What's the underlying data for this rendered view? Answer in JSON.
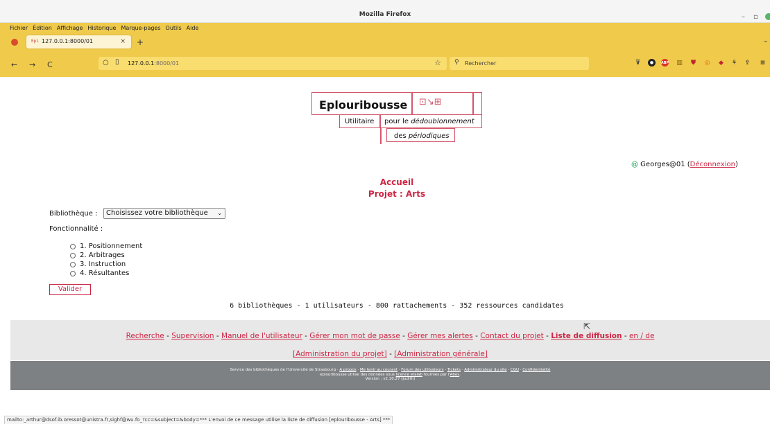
{
  "window": {
    "title": "Mozilla Firefox",
    "minimize": "–",
    "maximize": "▫"
  },
  "menu": [
    "Fichier",
    "Édition",
    "Affichage",
    "Historique",
    "Marque-pages",
    "Outils",
    "Aide"
  ],
  "tab": {
    "favicon_text": "Epi",
    "label": "127.0.0.1:8000/01",
    "close": "×",
    "new_tab": "+"
  },
  "nav": {
    "back": "←",
    "forward": "→",
    "reload": "C",
    "url_host": "127.0.0.1",
    "url_rest": ":8000/01",
    "star": "☆",
    "search_placeholder": "Rechercher",
    "menu_icon": "≡",
    "overflow_icon": "⌄"
  },
  "logo": {
    "name": "Eplouribousse",
    "icons": "⊡↘⊞",
    "utilitaire": "Utilitaire",
    "pour_prefix": "pour le ",
    "pour_italic": "dédoublonnement",
    "des_prefix": "des ",
    "des_italic": "périodiques"
  },
  "user": {
    "at": "@",
    "name": " Georges@01 (",
    "logout": "Déconnexion",
    "close_paren": ")"
  },
  "page": {
    "heading": "Accueil",
    "project": "Projet : Arts",
    "library_label": "Bibliothèque :",
    "library_select": "Choisissez votre bibliothèque",
    "select_arrow": "⌄",
    "function_label": "Fonctionnalité :",
    "options": [
      "1. Positionnement",
      "2. Arbitrages",
      "3. Instruction",
      "4. Résultantes"
    ],
    "submit": "Valider",
    "stats": "6 bibliothèques - 1 utilisateurs - 800 rattachements - 352 ressources candidates"
  },
  "footer": {
    "links": [
      "Recherche",
      "Supervision",
      "Manuel de l'utilisateur",
      "Gérer mon mot de passe",
      "Gérer mes alertes",
      "Contact du projet",
      "Liste de diffusion",
      "en / de"
    ],
    "separator": " - ",
    "admin_project": "[Administration du projet]",
    "admin_general": "[Administration générale]",
    "bottom_line1_prefix": "Service des bibliothèques de l'Université de Strasbourg · ",
    "bottom_links": [
      "A propos",
      "Me tenir au courant",
      "Forum des utilisateurs",
      "Tickets",
      "Administrateur du site",
      "CGU",
      "Confidentialité"
    ],
    "bottom_line2_prefix": "eplouribousse utilise des données sous ",
    "bottom_line2_link": "licence etalab",
    "bottom_line2_mid": " fournies par l'",
    "bottom_line2_link2": "Abes",
    "bottom_line2_end": ".",
    "version": "Version : v2.10.27 (Judith)"
  },
  "statusbar": "mailto:_arthur@dsof.ib.oressot@unistra.fr,sighf@wu.fo_?cc=&subject=&body=*** L'envoi de ce message utilise la liste de diffusion [eplouribousse - Arts] ***",
  "colors": {
    "accent": "#cc2644",
    "toolbar": "#f0ca4a",
    "footer_dark": "#7e8184"
  }
}
